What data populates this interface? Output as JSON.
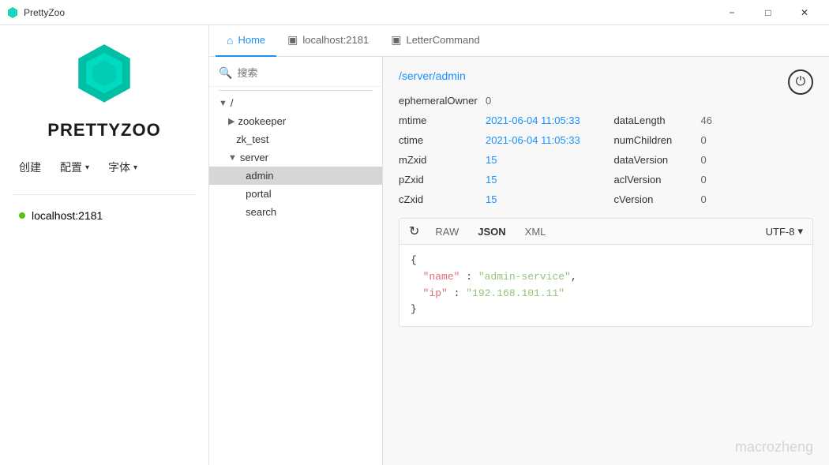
{
  "titlebar": {
    "title": "PrettyZoo",
    "minimize_label": "−",
    "maximize_label": "□",
    "close_label": "✕"
  },
  "sidebar": {
    "logo_text": "PRETTYZOO",
    "actions": {
      "create": "创建",
      "config": "配置",
      "config_arrow": "▾",
      "font": "字体",
      "font_arrow": "▾"
    },
    "server": {
      "name": "localhost:2181"
    }
  },
  "tabs": [
    {
      "id": "home",
      "label": "Home",
      "icon": "⌂",
      "active": true
    },
    {
      "id": "localhost",
      "label": "localhost:2181",
      "icon": "▣",
      "active": false
    },
    {
      "id": "letter",
      "label": "LetterCommand",
      "icon": "▣",
      "active": false
    }
  ],
  "search": {
    "placeholder": "搜索"
  },
  "tree": {
    "nodes": [
      {
        "label": "/",
        "indent": 0,
        "arrow": "▼",
        "type": "expanded"
      },
      {
        "label": "zookeeper",
        "indent": 1,
        "arrow": "▶",
        "type": "collapsed"
      },
      {
        "label": "zk_test",
        "indent": 1,
        "arrow": "",
        "type": "leaf"
      },
      {
        "label": "server",
        "indent": 1,
        "arrow": "▼",
        "type": "expanded"
      },
      {
        "label": "admin",
        "indent": 2,
        "arrow": "",
        "type": "selected"
      },
      {
        "label": "portal",
        "indent": 2,
        "arrow": "",
        "type": "leaf"
      },
      {
        "label": "search",
        "indent": 2,
        "arrow": "",
        "type": "leaf"
      }
    ]
  },
  "detail": {
    "path": "/server/admin",
    "properties": {
      "ephemeralOwner_label": "ephemeralOwner",
      "ephemeralOwner_value": "0",
      "mtime_label": "mtime",
      "mtime_value": "2021-06-04 11:05:33",
      "dataLength_label": "dataLength",
      "dataLength_value": "46",
      "ctime_label": "ctime",
      "ctime_value": "2021-06-04 11:05:33",
      "numChildren_label": "numChildren",
      "numChildren_value": "0",
      "mZxid_label": "mZxid",
      "mZxid_value": "15",
      "dataVersion_label": "dataVersion",
      "dataVersion_value": "0",
      "pZxid_label": "pZxid",
      "pZxid_value": "15",
      "aclVersion_label": "aclVersion",
      "aclVersion_value": "0",
      "cZxid_label": "cZxid",
      "cZxid_value": "15",
      "cVersion_label": "cVersion",
      "cVersion_value": "0"
    },
    "editor": {
      "format_raw": "RAW",
      "format_json": "JSON",
      "format_xml": "XML",
      "encoding": "UTF-8",
      "encoding_arrow": "▾",
      "content_line1": "{",
      "content_line2_key": "\"name\"",
      "content_line2_colon": " : ",
      "content_line2_value": "\"admin-service\"",
      "content_line2_comma": ",",
      "content_line3_key": "\"ip\"",
      "content_line3_colon": " : ",
      "content_line3_value": "\"192.168.101.11\"",
      "content_line4": "}"
    }
  },
  "watermark": "macrozheng"
}
